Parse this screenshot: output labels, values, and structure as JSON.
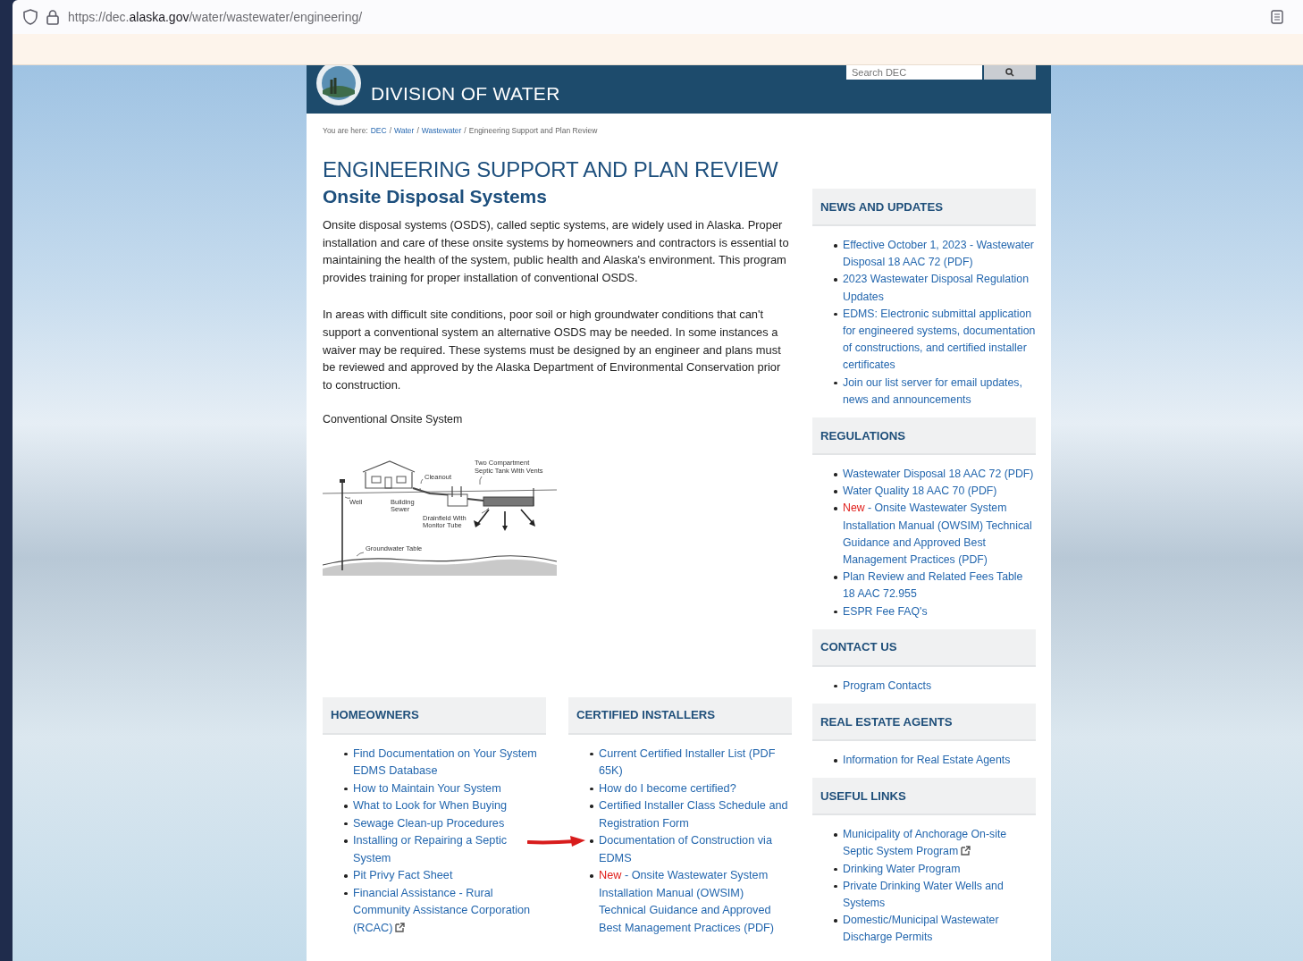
{
  "browser": {
    "url_prefix": "https://dec.",
    "url_domain": "alaska.gov",
    "url_path": "/water/wastewater/engineering/"
  },
  "header": {
    "site_title": "DIVISION OF WATER",
    "search": {
      "placeholder": "Search DEC"
    }
  },
  "breadcrumb": {
    "label": "You are here:",
    "separator": "/",
    "links": [
      "DEC",
      "Water",
      "Wastewater"
    ],
    "current": "Engineering Support and Plan Review"
  },
  "page_title": "ENGINEERING SUPPORT AND PLAN REVIEW",
  "subtitle": "Onsite Disposal Systems",
  "paragraphs": [
    "Onsite disposal systems (OSDS), called septic systems, are widely used in Alaska. Proper installation and care of these onsite systems by homeowners and contractors is essential to maintaining the health of the system, public health and Alaska's environment. This program provides training for proper installation of conventional OSDS.",
    "In areas with difficult site conditions, poor soil or high groundwater conditions that can't support a conventional system an alternative OSDS may be needed. In some instances a waiver may be required. These systems must be designed by an engineer and plans must be reviewed and approved by the Alaska Department of Environmental Conservation prior to construction."
  ],
  "figure": {
    "caption": "Conventional Onsite System",
    "labels": {
      "tank": "Two Compartment",
      "tank_2": "Septic Tank With Vents",
      "cleanout": "Cleanout",
      "sewer": "Building",
      "sewer_2": "Sewer",
      "well": "Well",
      "drainfield": "Drainfield With",
      "drainfield_2": "Monitor Tube",
      "groundwater": "Groundwater Table"
    }
  },
  "bottom_sections": [
    {
      "title": "HOMEOWNERS",
      "items": [
        {
          "text": "Find Documentation on Your System EDMS Database"
        },
        {
          "text": "How to Maintain Your System"
        },
        {
          "text": "What to Look for When Buying"
        },
        {
          "text": "Sewage Clean-up Procedures"
        },
        {
          "text": "Installing or Repairing a Septic System"
        },
        {
          "text": "Pit Privy Fact Sheet"
        },
        {
          "text": "Financial Assistance - Rural Community Assistance Corporation (RCAC)",
          "external": true
        }
      ]
    },
    {
      "title": "CERTIFIED INSTALLERS",
      "items": [
        {
          "text": "Current Certified Installer List (PDF 65K)"
        },
        {
          "text": "How do I become certified?"
        },
        {
          "text": "Certified Installer Class Schedule and Registration Form"
        },
        {
          "text": "Documentation of Construction via EDMS",
          "arrow": true
        },
        {
          "badge": "New",
          "text": "- Onsite Wastewater System Installation Manual (OWSIM) Technical Guidance and Approved Best Management Practices (PDF)"
        }
      ]
    }
  ],
  "sidebar": [
    {
      "title": "NEWS AND UPDATES",
      "items": [
        {
          "text": "Effective October 1, 2023 - Wastewater Disposal 18 AAC 72 (PDF)"
        },
        {
          "text": "2023 Wastewater Disposal Regulation Updates"
        },
        {
          "text": "EDMS: Electronic submittal application for engineered systems, documentation of constructions, and certified installer certificates"
        },
        {
          "text": "Join our list server for email updates, news and announcements"
        }
      ]
    },
    {
      "title": "REGULATIONS",
      "items": [
        {
          "text": "Wastewater Disposal 18 AAC 72 (PDF)"
        },
        {
          "text": "Water Quality 18 AAC 70 (PDF)"
        },
        {
          "badge": "New",
          "text": "- Onsite Wastewater System Installation Manual (OWSIM) Technical Guidance and Approved Best Management Practices (PDF)"
        },
        {
          "text": "Plan Review and Related Fees Table 18 AAC 72.955"
        },
        {
          "text": "ESPR Fee FAQ's"
        }
      ]
    },
    {
      "title": "CONTACT US",
      "items": [
        {
          "text": "Program Contacts"
        }
      ]
    },
    {
      "title": "REAL ESTATE AGENTS",
      "items": [
        {
          "text": "Information for Real Estate Agents"
        }
      ]
    },
    {
      "title": "USEFUL LINKS",
      "items": [
        {
          "text": "Municipality of Anchorage On-site Septic System Program",
          "external": true
        },
        {
          "text": "Drinking Water Program"
        },
        {
          "text": "Private Drinking Water Wells and Systems"
        },
        {
          "text": "Domestic/Municipal Wastewater Discharge Permits"
        }
      ]
    }
  ]
}
